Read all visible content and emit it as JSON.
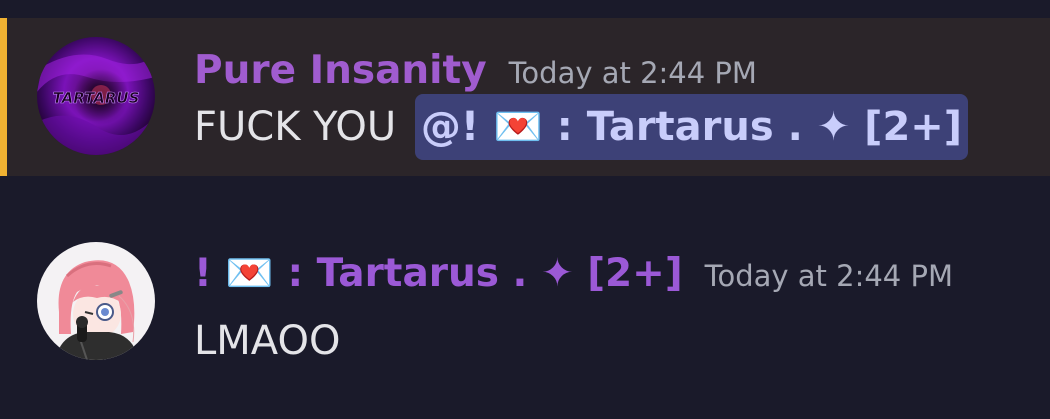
{
  "messages": [
    {
      "author": "Pure Insanity",
      "timestamp": "Today at 2:44 PM",
      "text": "FUCK YOU",
      "mention": "@! 💌 : Tartarus . ✦ [2+]",
      "avatar_text": "TARTARUS",
      "highlighted": true
    },
    {
      "author": "! 💌 : Tartarus . ✦ [2+]",
      "timestamp": "Today at 2:44 PM",
      "text": "LMAOO"
    }
  ],
  "colors": {
    "background": "#1a1a2a",
    "highlight_background": "#2b2529",
    "highlight_bar": "#f0b232",
    "username_1": "#a05ccf",
    "username_2": "#9b59d6",
    "timestamp": "#a5a8b4",
    "mention_background": "#3d4177",
    "mention_text": "#c9cdfb"
  }
}
